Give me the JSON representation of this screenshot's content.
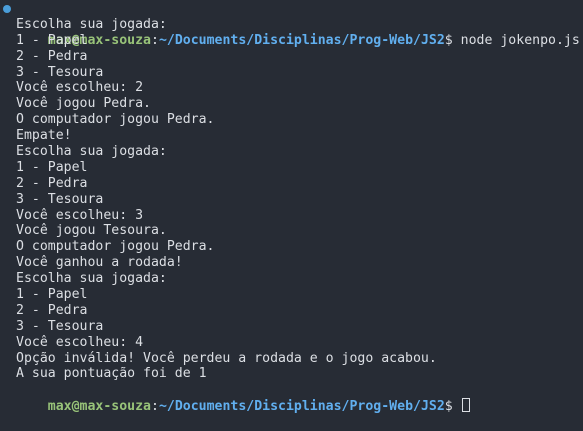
{
  "prompt": {
    "user_host": "max@max-souza",
    "separator": ":",
    "path": "~/Documents/Disciplinas/Prog-Web/JS2",
    "symbol": "$",
    "command": "node jokenpo.js"
  },
  "output": [
    "Escolha sua jogada:",
    "1 - Papel",
    "2 - Pedra",
    "3 - Tesoura",
    "Você escolheu: 2",
    "Você jogou Pedra.",
    "O computador jogou Pedra.",
    "Empate!",
    "Escolha sua jogada:",
    "1 - Papel",
    "2 - Pedra",
    "3 - Tesoura",
    "Você escolheu: 3",
    "Você jogou Tesoura.",
    "O computador jogou Pedra.",
    "Você ganhou a rodada!",
    "Escolha sua jogada:",
    "1 - Papel",
    "2 - Pedra",
    "3 - Tesoura",
    "Você escolheu: 4",
    "Opção inválida! Você perdeu a rodada e o jogo acabou.",
    "A sua pontuação foi de 1"
  ],
  "final_prompt": {
    "user_host": "max@max-souza",
    "separator": ":",
    "path": "~/Documents/Disciplinas/Prog-Web/JS2",
    "symbol": "$"
  },
  "colors": {
    "background": "#272c35",
    "user_host": "#98c379",
    "path": "#61afef",
    "text": "#dcdfe4",
    "status_dot": "#4a9eda"
  }
}
